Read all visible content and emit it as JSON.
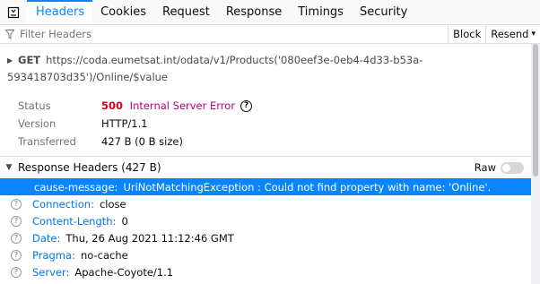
{
  "tabs": [
    {
      "label": "Headers",
      "selected": true
    },
    {
      "label": "Cookies"
    },
    {
      "label": "Request"
    },
    {
      "label": "Response"
    },
    {
      "label": "Timings"
    },
    {
      "label": "Security"
    }
  ],
  "toolbar": {
    "filter_placeholder": "Filter Headers",
    "block_label": "Block",
    "resend_label": "Resend"
  },
  "request": {
    "method": "GET",
    "url": "https://coda.eumetsat.int/odata/v1/Products('080eef3e-0eb4-4d33-b53a-593418703d35')/Online/$value"
  },
  "summary": {
    "status_label": "Status",
    "status_code": "500",
    "status_text": "Internal Server Error",
    "version_label": "Version",
    "version_value": "HTTP/1.1",
    "transferred_label": "Transferred",
    "transferred_value": "427 B (0 B size)"
  },
  "response_headers": {
    "title": "Response Headers (427 B)",
    "raw_label": "Raw",
    "items": [
      {
        "name": "cause-message:",
        "value": "UriNotMatchingException : Could not find property with name: 'Online'."
      },
      {
        "name": "Connection:",
        "value": "close"
      },
      {
        "name": "Content-Length:",
        "value": "0"
      },
      {
        "name": "Date:",
        "value": "Thu, 26 Aug 2021 11:12:46 GMT"
      },
      {
        "name": "Pragma:",
        "value": "no-cache"
      },
      {
        "name": "Server:",
        "value": "Apache-Coyote/1.1"
      }
    ]
  },
  "colors": {
    "accent": "#0a84ff",
    "status_error": "#b5007f",
    "header_name": "#0074e8"
  }
}
